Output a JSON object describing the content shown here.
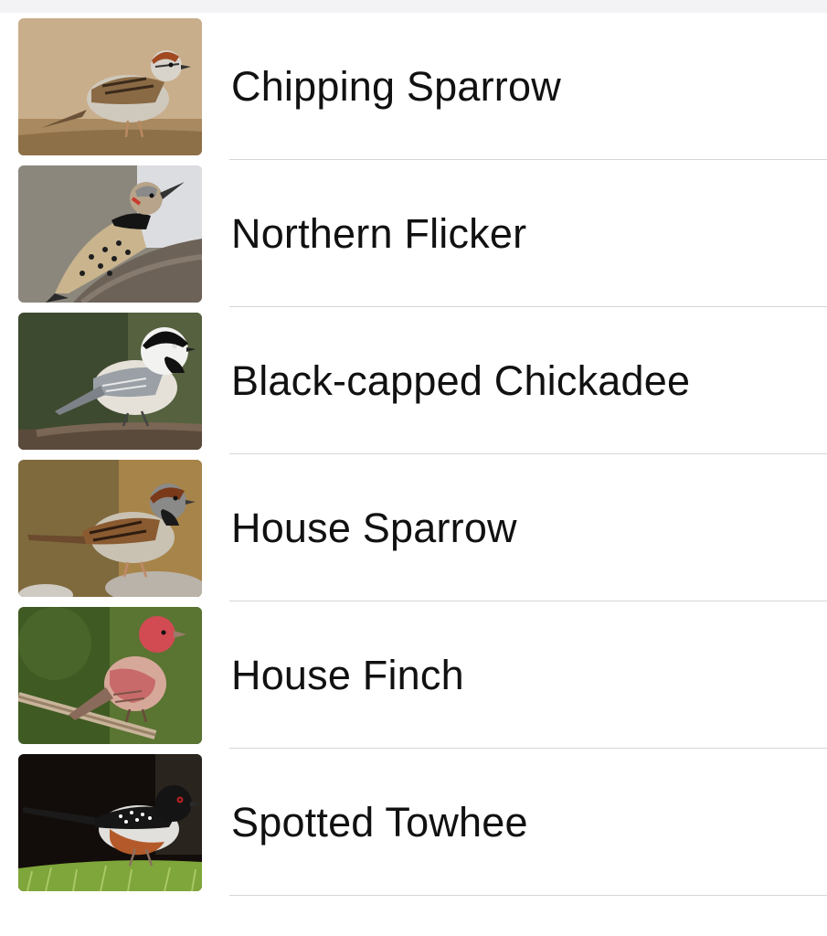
{
  "colors": {
    "background": "#ffffff",
    "text": "#111111",
    "separator": "#d6d6da",
    "top_bar": "#f3f3f5"
  },
  "birds": [
    {
      "name": "Chipping Sparrow",
      "image": "chipping-sparrow-photo"
    },
    {
      "name": "Northern Flicker",
      "image": "northern-flicker-photo"
    },
    {
      "name": "Black-capped Chickadee",
      "image": "black-capped-chickadee-photo"
    },
    {
      "name": "House Sparrow",
      "image": "house-sparrow-photo"
    },
    {
      "name": "House Finch",
      "image": "house-finch-photo"
    },
    {
      "name": "Spotted Towhee",
      "image": "spotted-towhee-photo"
    }
  ]
}
